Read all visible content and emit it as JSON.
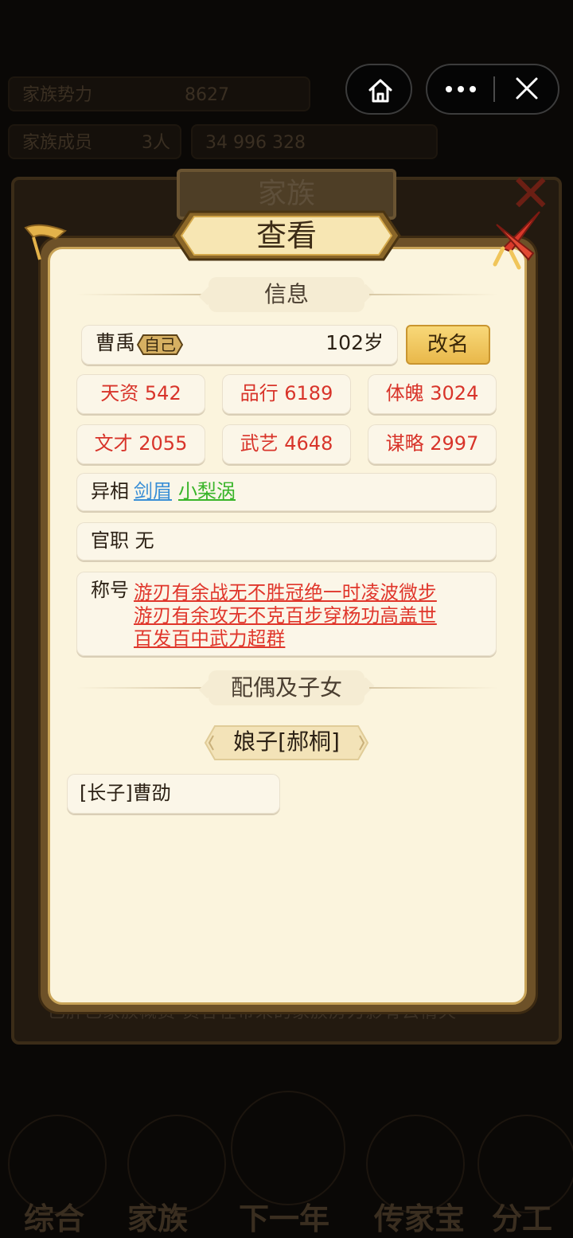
{
  "background": {
    "top_bar_1": "家族势力",
    "top_bar_1_value": "8627",
    "top_bar_2": "家族成员",
    "top_bar_2_value": "3人",
    "top_bar_3": "34  996  328",
    "back_dialog_title": "家族",
    "back_text_row": "已肝已家族概费 员各在带来的家族房力影有云情天",
    "nav": [
      "综合",
      "家族",
      "下一年",
      "传家宝",
      "分工"
    ]
  },
  "capsule": {
    "home_icon": "home-icon",
    "more_icon": "more-dots-icon",
    "close_icon": "close-x-icon"
  },
  "dialog": {
    "title": "查看",
    "close_icon": "close-swords-icon"
  },
  "info": {
    "section_title": "信息",
    "name": "曹禹",
    "self_badge": "自己",
    "age": "102岁",
    "rename_button": "改名",
    "stats": [
      {
        "label": "天资 542"
      },
      {
        "label": "品行 6189"
      },
      {
        "label": "体魄 3024"
      },
      {
        "label": "文才 2055"
      },
      {
        "label": "武艺 4648"
      },
      {
        "label": "谋略 2997"
      }
    ],
    "appearance_label": "异相",
    "traits": [
      {
        "text": "剑眉",
        "color": "#3a8fd6"
      },
      {
        "text": "小梨涡",
        "color": "#3ab52a"
      }
    ],
    "office_label": "官职",
    "office_value": "无",
    "titles_label": "称号",
    "titles_lines": [
      "游刃有余战无不胜冠绝一时凌波微步",
      "游刃有余攻无不克百步穿杨功高盖世",
      "百发百中武力超群"
    ]
  },
  "family": {
    "section_title": "配偶及子女",
    "spouse": "娘子[郝桐]",
    "children": [
      "[长子]曹劭"
    ]
  },
  "colors": {
    "stat_text": "#d8342a",
    "title_text": "#e0362b",
    "panel_bg": "#fbf4dd",
    "button_gold": "#e9b84a"
  }
}
